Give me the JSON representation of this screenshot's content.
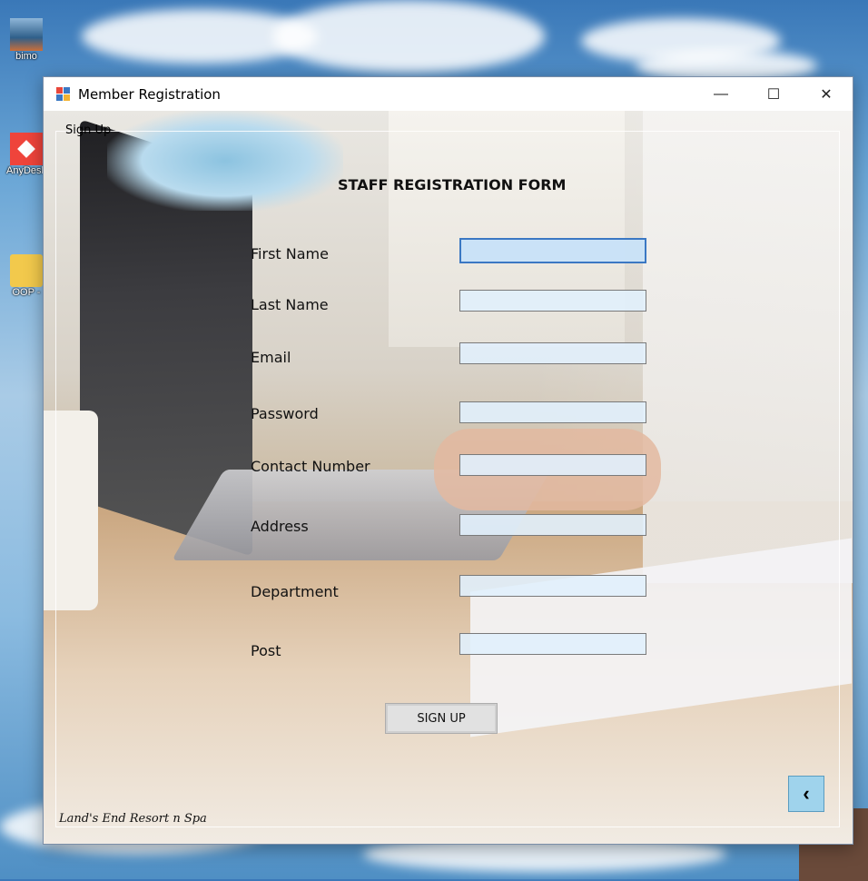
{
  "desktop": {
    "icons": [
      {
        "label": "bimo",
        "icon": "photo-thumbnail-icon"
      },
      {
        "label": "AnyDesk",
        "icon": "anydesk-icon"
      },
      {
        "label": "OOP -",
        "icon": "folder-icon"
      }
    ]
  },
  "window": {
    "title": "Member Registration",
    "icon": "form-app-icon",
    "controls": {
      "minimize": "—",
      "maximize": "☐",
      "close": "✕"
    }
  },
  "form": {
    "group_label": "Sign Up",
    "title": "STAFF REGISTRATION FORM",
    "fields": [
      {
        "label": "First Name",
        "value": "",
        "focused": true
      },
      {
        "label": "Last Name",
        "value": ""
      },
      {
        "label": "Email",
        "value": ""
      },
      {
        "label": "Password",
        "value": ""
      },
      {
        "label": "Contact Number",
        "value": ""
      },
      {
        "label": "Address",
        "value": ""
      },
      {
        "label": "Department",
        "value": ""
      },
      {
        "label": "Post",
        "value": ""
      }
    ],
    "submit_label": "SIGN UP",
    "back_label": "‹",
    "brand": "Land's End Resort n Spa"
  },
  "colors": {
    "input_bg": "#e1f0fc",
    "input_focus_border": "#3b78c3",
    "back_button_bg": "#9fd3ec"
  }
}
